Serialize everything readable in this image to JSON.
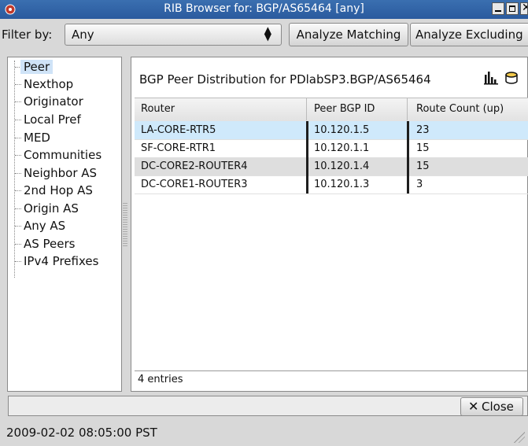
{
  "window": {
    "title": "RIB Browser for: BGP/AS65464 [any]"
  },
  "filter": {
    "label": "Filter by:",
    "value": "Any"
  },
  "buttons": {
    "analyze_matching": "Analyze Matching",
    "analyze_excluding": "Analyze Excluding",
    "close": "Close"
  },
  "tree": {
    "items": [
      "Peer",
      "Nexthop",
      "Originator",
      "Local Pref",
      "MED",
      "Communities",
      "Neighbor AS",
      "2nd Hop AS",
      "Origin AS",
      "Any AS",
      "AS Peers",
      "IPv4 Prefixes"
    ],
    "selected": "Peer"
  },
  "panel": {
    "title": "BGP Peer Distribution for PDlabSP3.BGP/AS65464",
    "columns": [
      "Router",
      "Peer BGP ID",
      "Route Count (up)"
    ],
    "rows": [
      {
        "router": "LA-CORE-RTR5",
        "peer_id": "10.120.1.5",
        "count": "23"
      },
      {
        "router": "SF-CORE-RTR1",
        "peer_id": "10.120.1.1",
        "count": "15"
      },
      {
        "router": "DC-CORE2-ROUTER4",
        "peer_id": "10.120.1.4",
        "count": "15"
      },
      {
        "router": "DC-CORE1-ROUTER3",
        "peer_id": "10.120.1.3",
        "count": "3"
      }
    ],
    "footer": "4 entries"
  },
  "status": {
    "timestamp": "2009-02-02 08:05:00 PST"
  },
  "icons": {
    "chart": "bar-chart-icon",
    "database": "database-icon",
    "app": "app-icon"
  }
}
